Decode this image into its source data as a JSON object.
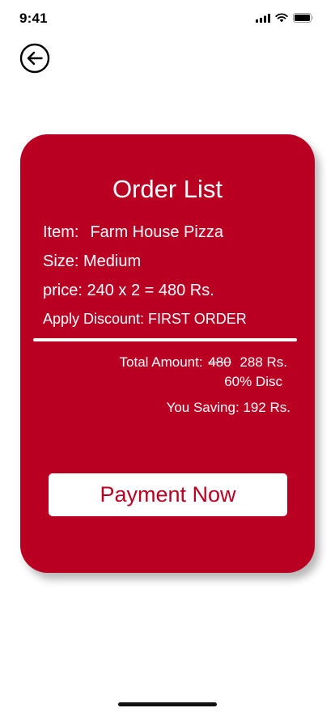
{
  "status_bar": {
    "time": "9:41",
    "icons": [
      "cellular-signal-icon",
      "wifi-icon",
      "battery-icon"
    ]
  },
  "header": {
    "back_icon": "arrow-left-circle-icon"
  },
  "order": {
    "title": "Order List",
    "item_label": "Item:",
    "item_value": "Farm House Pizza",
    "size_line": "Size: Medium",
    "price_line": "price: 240 x 2 = 480 Rs.",
    "discount_line": "Apply Discount: FIRST ORDER",
    "total_label": "Total Amount:",
    "original_amount": "480",
    "final_amount": "288 Rs.",
    "discount_percent": "60% Disc",
    "saving_line": "You Saving: 192 Rs.",
    "payment_button_label": "Payment Now"
  },
  "colors": {
    "card_background": "#b90022",
    "button_text": "#b90022",
    "text_on_card": "#ffffff"
  }
}
